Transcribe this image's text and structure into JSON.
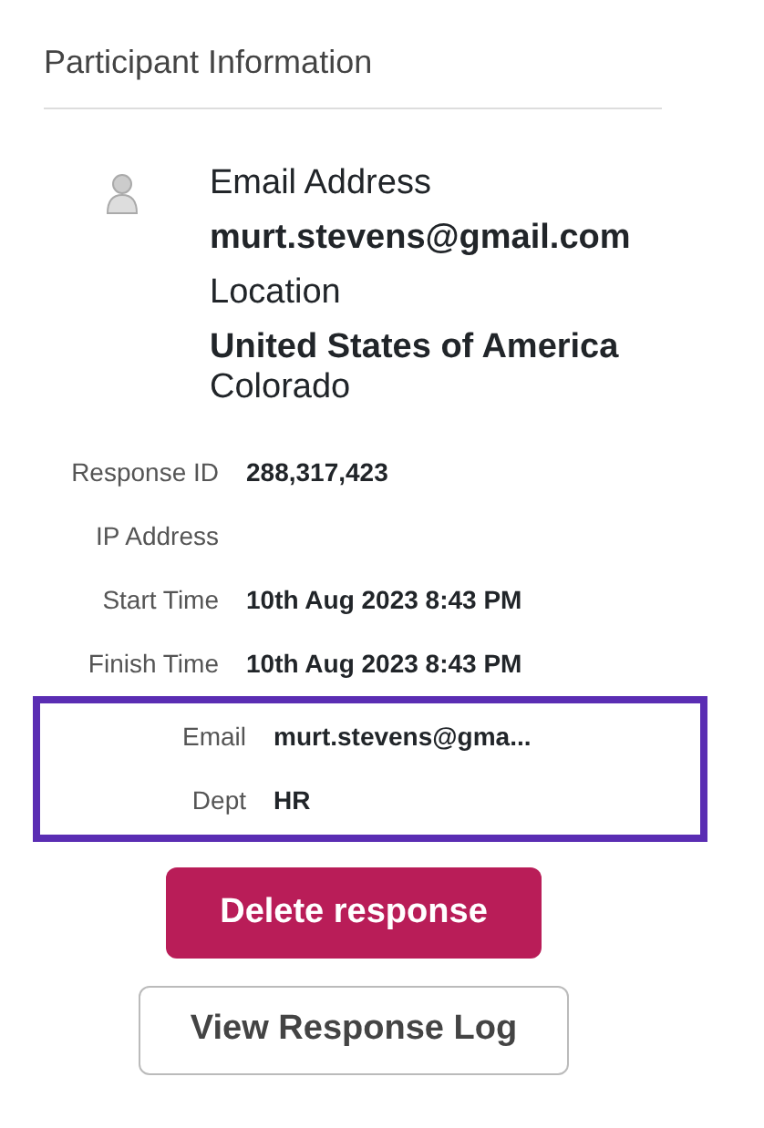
{
  "heading": "Participant Information",
  "participant": {
    "fields": [
      {
        "label": "Email Address",
        "value": "murt.stevens@gmail.com"
      },
      {
        "label": "Location",
        "value": "United States of America",
        "extra": "Colorado"
      }
    ]
  },
  "details": [
    {
      "label": "Response ID",
      "value": "288,317,423"
    },
    {
      "label": "IP Address"
    },
    {
      "label": "Start Time",
      "value": "10th Aug 2023 8:43 PM"
    },
    {
      "label": "Finish Time",
      "value": "10th Aug 2023 8:43 PM"
    }
  ],
  "highlighted_details": [
    {
      "label": "Email",
      "value": "murt.stevens@gma..."
    },
    {
      "label": "Dept",
      "value": "HR"
    }
  ],
  "buttons": [
    {
      "label": "Delete response",
      "kind": "danger"
    },
    {
      "label": "View Response Log",
      "kind": "outline"
    }
  ]
}
